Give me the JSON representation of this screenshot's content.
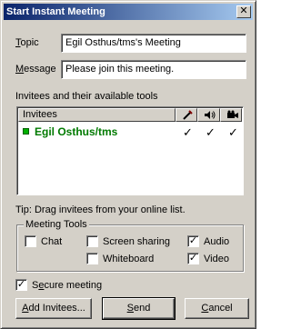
{
  "window": {
    "title": "Start Instant Meeting",
    "close_glyph": "✕"
  },
  "topic": {
    "label_underlined": "T",
    "label_rest": "opic",
    "value": "Egil Osthus/tms's Meeting"
  },
  "message": {
    "label_underlined": "M",
    "label_rest": "essage",
    "value": "Please join this meeting."
  },
  "invitees": {
    "section_label": "Invitees and their available tools",
    "column_header": "Invitees",
    "tool_icons": [
      "pen-icon",
      "speaker-icon",
      "video-camera-icon"
    ],
    "rows": [
      {
        "name": "Egil Osthus/tms",
        "status_color": "#00b000",
        "tools": [
          "✓",
          "✓",
          "✓"
        ]
      }
    ]
  },
  "tip": "Tip: Drag invitees from your online list.",
  "meeting_tools": {
    "legend": "Meeting Tools",
    "options": [
      {
        "label": "Chat",
        "checked": false,
        "mark": ""
      },
      {
        "label": "Screen sharing",
        "checked": false,
        "mark": ""
      },
      {
        "label": "Audio",
        "checked": true,
        "mark": "✓"
      },
      {
        "label": "Whiteboard",
        "checked": false,
        "mark": ""
      },
      {
        "label": "Video",
        "checked": true,
        "mark": "✓"
      }
    ]
  },
  "secure": {
    "label_pre": "S",
    "label_underlined": "e",
    "label_rest": "cure meeting",
    "checked": true,
    "mark": "✓"
  },
  "buttons": {
    "add_underlined": "A",
    "add_rest": "dd Invitees...",
    "send_underlined": "S",
    "send_rest": "end",
    "cancel_underlined": "C",
    "cancel_rest": "ancel"
  },
  "colors": {
    "title_start": "#0a246a",
    "title_end": "#a6caf0",
    "face": "#d4d0c8",
    "invitee_text": "#007a00"
  }
}
